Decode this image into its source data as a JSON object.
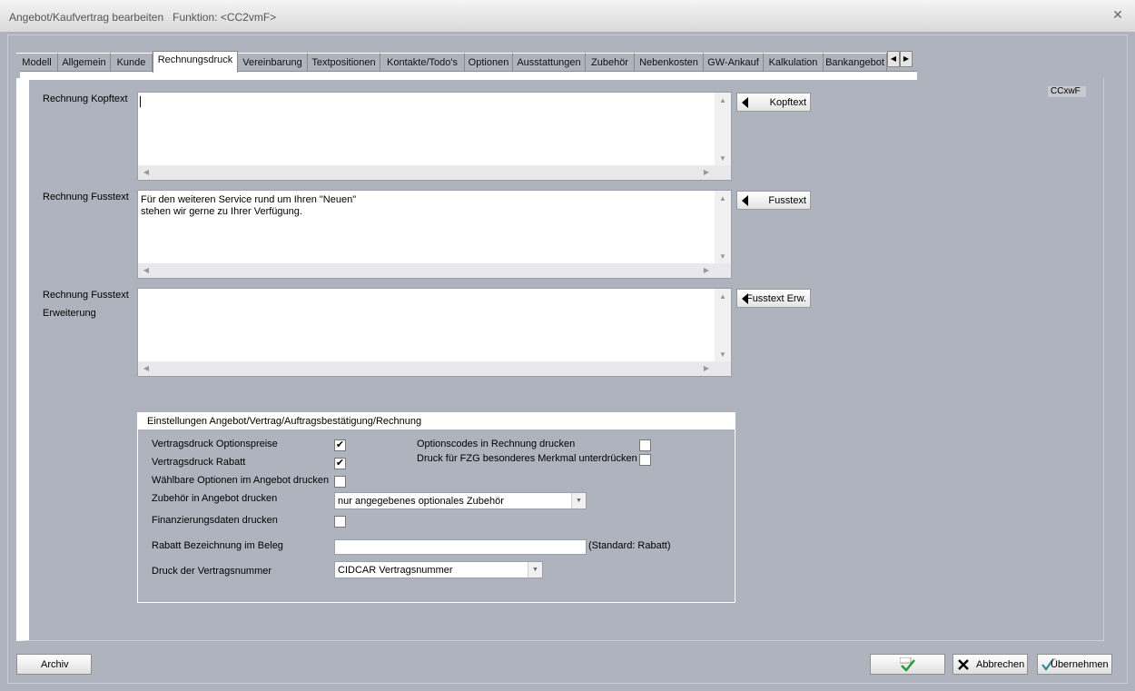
{
  "window": {
    "title": "Angebot/Kaufvertrag bearbeiten",
    "function_label": "Funktion: <CC2vmF>",
    "close_glyph": "✕"
  },
  "tabs": [
    {
      "label": "Modell"
    },
    {
      "label": "Allgemein"
    },
    {
      "label": "Kunde"
    },
    {
      "label": "Rechnungsdruck",
      "active": true
    },
    {
      "label": "Vereinbarung"
    },
    {
      "label": "Textpositionen"
    },
    {
      "label": "Kontakte/Todo's"
    },
    {
      "label": "Optionen"
    },
    {
      "label": "Ausstattungen"
    },
    {
      "label": "Zubehör"
    },
    {
      "label": "Nebenkosten"
    },
    {
      "label": "GW-Ankauf"
    },
    {
      "label": "Kalkulation"
    },
    {
      "label": "Bankangebot"
    }
  ],
  "panel_code": "CCxwF",
  "fields": {
    "kopftext": {
      "label": "Rechnung Kopftext",
      "value": "",
      "button": "Kopftext"
    },
    "fusstext": {
      "label": "Rechnung Fusstext",
      "value": "Für den weiteren Service rund um Ihren \"Neuen\"\nstehen wir gerne zu Ihrer Verfügung.",
      "button": "Fusstext"
    },
    "fusstext_erw": {
      "label_line1": "Rechnung Fusstext",
      "label_line2": "Erweiterung",
      "value": "",
      "button": "Fusstext Erw."
    }
  },
  "settings": {
    "title": "Einstellungen Angebot/Vertrag/Auftragsbestätigung/Rechnung",
    "vertragsdruck_optionspreise": {
      "label": "Vertragsdruck Optionspreise",
      "checked": true
    },
    "vertragsdruck_rabatt": {
      "label": "Vertragsdruck Rabatt",
      "checked": true
    },
    "waehlbare_optionen": {
      "label": "Wählbare Optionen im Angebot drucken",
      "checked": false
    },
    "zubehoer": {
      "label": "Zubehör in Angebot drucken",
      "value": "nur angegebenes optionales Zubehör"
    },
    "finanzierungsdaten": {
      "label": "Finanzierungsdaten drucken",
      "checked": false
    },
    "rabatt_bezeichnung": {
      "label": "Rabatt Bezeichnung im Beleg",
      "value": "",
      "hint": "(Standard: Rabatt)"
    },
    "vertragsnummer": {
      "label": "Druck der Vertragsnummer",
      "value": "CIDCAR Vertragsnummer"
    },
    "optionscodes": {
      "label": "Optionscodes in Rechnung drucken",
      "checked": false
    },
    "fzg_merkmal": {
      "label": "Druck für FZG besonderes Merkmal unterdrücken",
      "checked": false
    }
  },
  "buttons": {
    "archiv": "Archiv",
    "ok": "",
    "abbrechen": "Abbrechen",
    "uebernehmen": "Übernehmen"
  },
  "colors": {
    "window_bg": "#aeb3bd",
    "ok_check": "#2a9d3a"
  }
}
